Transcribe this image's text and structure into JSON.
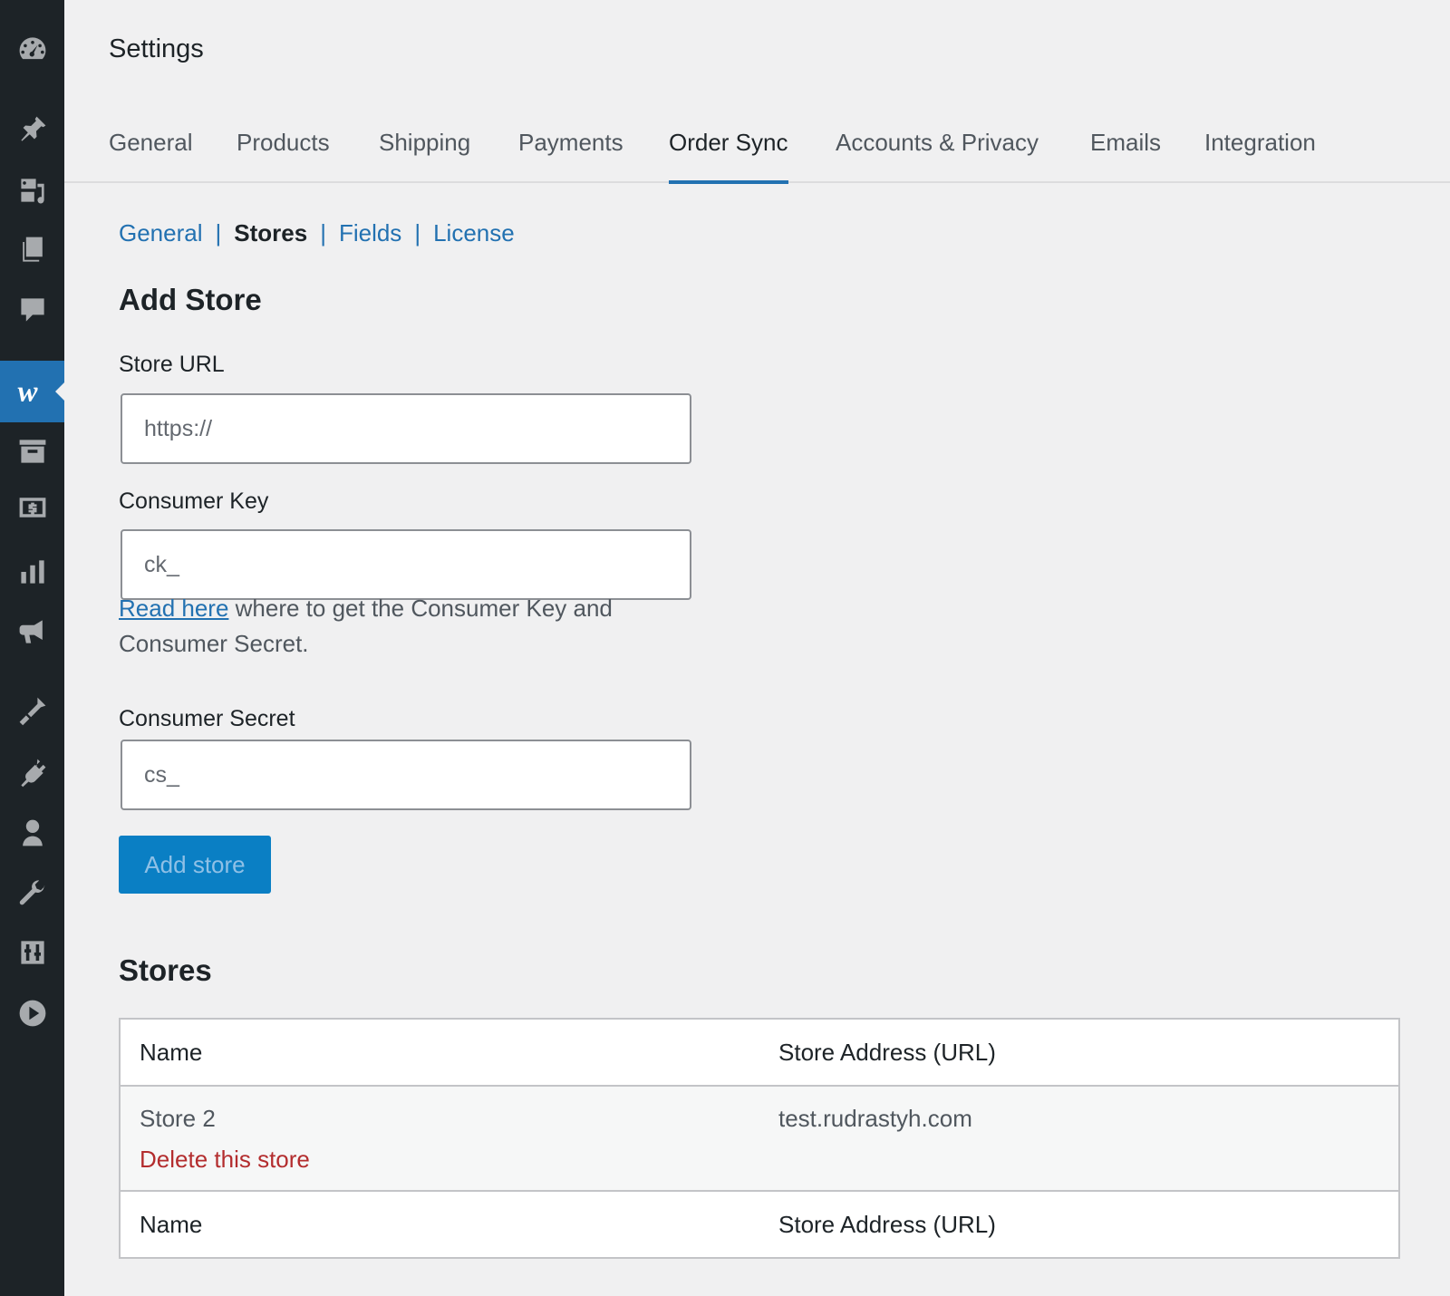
{
  "page": {
    "title": "Settings"
  },
  "tabs": [
    {
      "label": "General"
    },
    {
      "label": "Products"
    },
    {
      "label": "Shipping"
    },
    {
      "label": "Payments"
    },
    {
      "label": "Order Sync",
      "active": true
    },
    {
      "label": "Accounts & Privacy"
    },
    {
      "label": "Emails"
    },
    {
      "label": "Integration"
    }
  ],
  "subnav": [
    {
      "label": "General"
    },
    {
      "label": "Stores",
      "current": true
    },
    {
      "label": "Fields"
    },
    {
      "label": "License"
    }
  ],
  "subnav_separator": "|",
  "add_store": {
    "heading": "Add Store",
    "store_url": {
      "label": "Store URL",
      "placeholder": "https://",
      "value": ""
    },
    "consumer_key": {
      "label": "Consumer Key",
      "placeholder": "ck_",
      "value": ""
    },
    "help": {
      "link_text": "Read here",
      "text": " where to get the Consumer Key and Consumer Secret."
    },
    "consumer_secret": {
      "label": "Consumer Secret",
      "placeholder": "cs_",
      "value": ""
    },
    "button_label": "Add store"
  },
  "stores": {
    "heading": "Stores",
    "columns": [
      "Name",
      "Store Address (URL)"
    ],
    "rows": [
      {
        "name": "Store 2",
        "url": "test.rudrastyh.com",
        "action": "Delete this store"
      }
    ]
  },
  "sidebar": {
    "icons": [
      "dashboard-icon",
      "pin-icon",
      "media-icon",
      "pages-icon",
      "comments-icon",
      "woocommerce-icon",
      "archive-icon",
      "payments-icon",
      "analytics-icon",
      "marketing-icon",
      "appearance-icon",
      "plugins-icon",
      "users-icon",
      "tools-icon",
      "settings-icon",
      "play-icon"
    ],
    "active": "woocommerce-icon"
  },
  "colors": {
    "accent": "#2271b1",
    "sidebar": "#1d2327",
    "delete": "#b32d2e",
    "button": "#0a7fc4"
  }
}
